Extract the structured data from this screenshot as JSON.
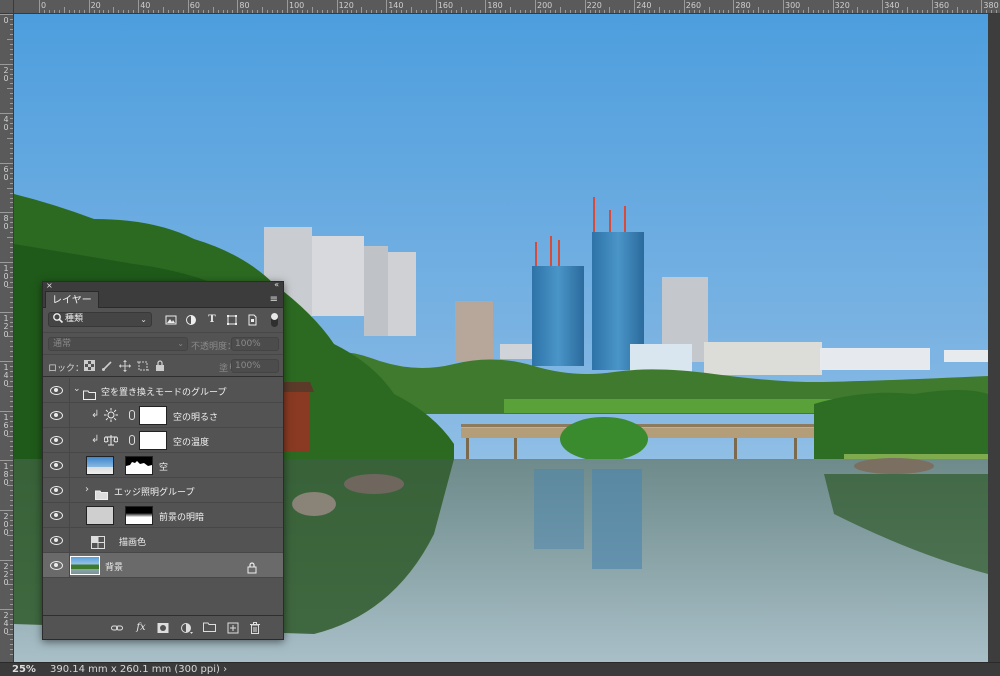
{
  "rulers": {
    "top": [
      "0",
      "20",
      "40",
      "60",
      "80",
      "100",
      "120",
      "140",
      "160",
      "180",
      "200",
      "220",
      "240",
      "260",
      "280",
      "300",
      "320",
      "340",
      "360",
      "380"
    ],
    "left": [
      "0",
      "20",
      "40",
      "60",
      "80",
      "100",
      "120",
      "140",
      "160",
      "180",
      "200",
      "220",
      "240"
    ]
  },
  "status": {
    "zoom": "25%",
    "doc_info": "390.14 mm x 260.1 mm (300 ppi) ›"
  },
  "panel": {
    "title": "レイヤー",
    "close_glyph": "×",
    "collapse_glyph": "«",
    "menu_glyph": "≡",
    "filter": {
      "label": "種類",
      "search_glyph": "🔍"
    },
    "filter_icons": [
      "image-filter-icon",
      "adjustment-filter-icon",
      "type-filter-icon",
      "shape-filter-icon",
      "smart-object-filter-icon"
    ],
    "blend_mode": "通常",
    "opacity_label": "不透明度：",
    "opacity_value": "100%",
    "lock_label": "ロック：",
    "fill_label": "塗り：",
    "fill_value": "100%",
    "layers": [
      {
        "name": "空を置き換えモードのグループ",
        "type": "group"
      },
      {
        "name": "空の明るさ",
        "type": "adjustment"
      },
      {
        "name": "空の温度",
        "type": "adjustment"
      },
      {
        "name": "空",
        "type": "image"
      },
      {
        "name": "エッジ照明グループ",
        "type": "group"
      },
      {
        "name": "前景の明暗",
        "type": "image"
      },
      {
        "name": "描画色",
        "type": "fill"
      },
      {
        "name": "背景",
        "type": "background"
      }
    ]
  },
  "colors": {
    "sky_top": "#4d9ede",
    "sky_bottom": "#a8cbe9",
    "panel_bg": "#535353",
    "selected": "#6a6a6a"
  }
}
